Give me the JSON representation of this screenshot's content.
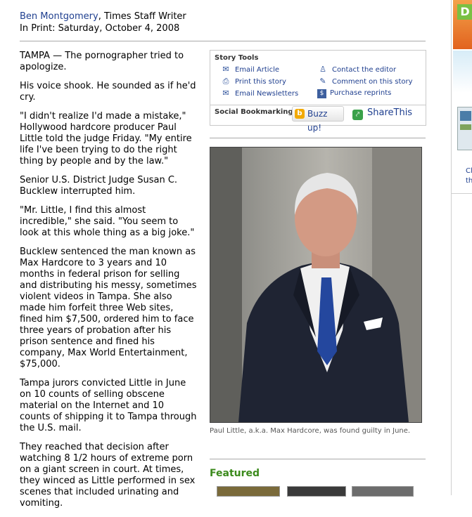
{
  "byline": {
    "author": "Ben Montgomery",
    "role": ", Times Staff Writer",
    "print_date": "In Print: Saturday, October 4, 2008"
  },
  "article": {
    "paragraphs": [
      "TAMPA — The pornographer tried to apologize.",
      "His voice shook. He sounded as if he'd cry.",
      "\"I didn't realize I'd made a mistake,\" Hollywood hardcore producer Paul Little told the judge Friday. \"My entire life I've been trying to do the right thing by people and by the law.\"",
      "Senior U.S. District Judge Susan C. Bucklew interrupted him.",
      "\"Mr. Little, I find this almost incredible,\" she said. \"You seem to look at this whole thing as a big joke.\"",
      "Bucklew sentenced the man known as Max Hardcore to 3 years and 10 months in federal prison for selling and distributing his messy, sometimes violent videos in Tampa. She also made him forfeit three Web sites, fined him $7,500, ordered him to face three years of probation after his prison sentence and fined his company, Max World Entertainment, $75,000.",
      "Tampa jurors convicted Little in June on 10 counts of selling obscene material on the Internet and 10 counts of shipping it to Tampa through the U.S. mail.",
      "They reached that decision after watching 8 1/2 hours of extreme porn on a giant screen in court. At times, they winced as Little performed in sex scenes that included urinating and vomiting."
    ]
  },
  "story_tools": {
    "title": "Story Tools",
    "email_article": "Email Article",
    "print_story": "Print this story",
    "email_newsletters": "Email Newsletters",
    "contact_editor": "Contact the editor",
    "comment": "Comment on this story",
    "purchase_reprints": "Purchase reprints"
  },
  "social": {
    "title": "Social Bookmarking",
    "buzz_label": "Buzz up!",
    "share_label": "ShareThis"
  },
  "photo": {
    "caption": "Paul Little, a.k.a. Max Hardcore, was found guilty in June."
  },
  "featured": {
    "title": "Featured"
  },
  "right_column": {
    "partial_letter": "D",
    "partial_link_1": "Cl",
    "partial_link_2": "th"
  },
  "colors": {
    "link": "#1f3f8f",
    "featured_green": "#3b8a1c",
    "share_green": "#3aa14a",
    "buzz_orange": "#f2a900"
  }
}
